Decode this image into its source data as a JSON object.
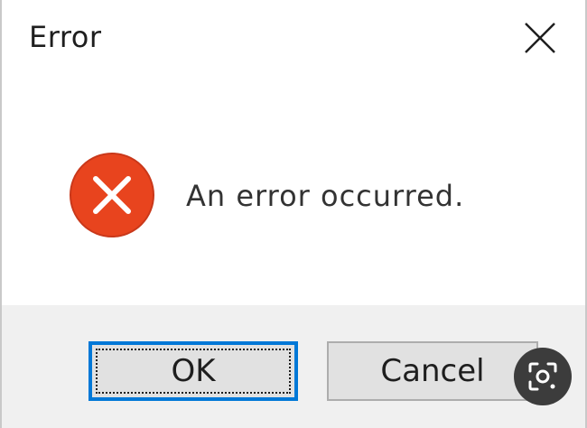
{
  "dialog": {
    "title": "Error",
    "message": "An error occurred.",
    "icon": "error-icon",
    "close_icon": "close-icon"
  },
  "buttons": {
    "ok_label": "OK",
    "cancel_label": "Cancel"
  },
  "overlay": {
    "icon": "lens-icon"
  },
  "colors": {
    "error_red": "#e8441e",
    "focus_blue": "#0078d7",
    "footer_bg": "#f0f0f0",
    "button_bg": "#e1e1e1"
  }
}
